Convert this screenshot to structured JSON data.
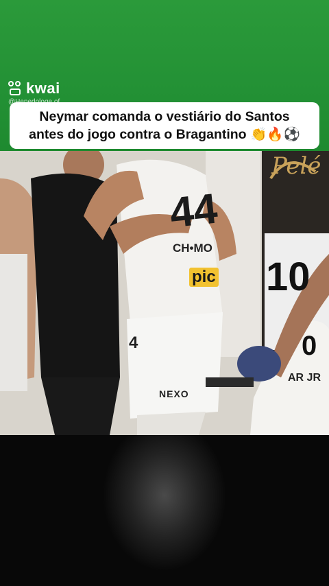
{
  "watermark": {
    "brand": "kwai",
    "handle": "@Henedoloqe.of"
  },
  "caption": {
    "line1": "Neymar comanda o vestiário do Santos",
    "line2": "antes do jogo contra o Bragantino 👏🔥⚽"
  },
  "scene": {
    "jersey_back_number": "44",
    "jersey_back_name": "CH•MO",
    "sponsor_back": "pic",
    "shorts_number": "4",
    "shorts_brand": "NEXO",
    "poster_text": "Pelé",
    "poster_number": "10",
    "right_jersey_name": "AR JR",
    "right_jersey_number": "0"
  },
  "colors": {
    "top_band": "#239135",
    "caption_bg": "#ffffff",
    "lower_bg": "#000000"
  }
}
